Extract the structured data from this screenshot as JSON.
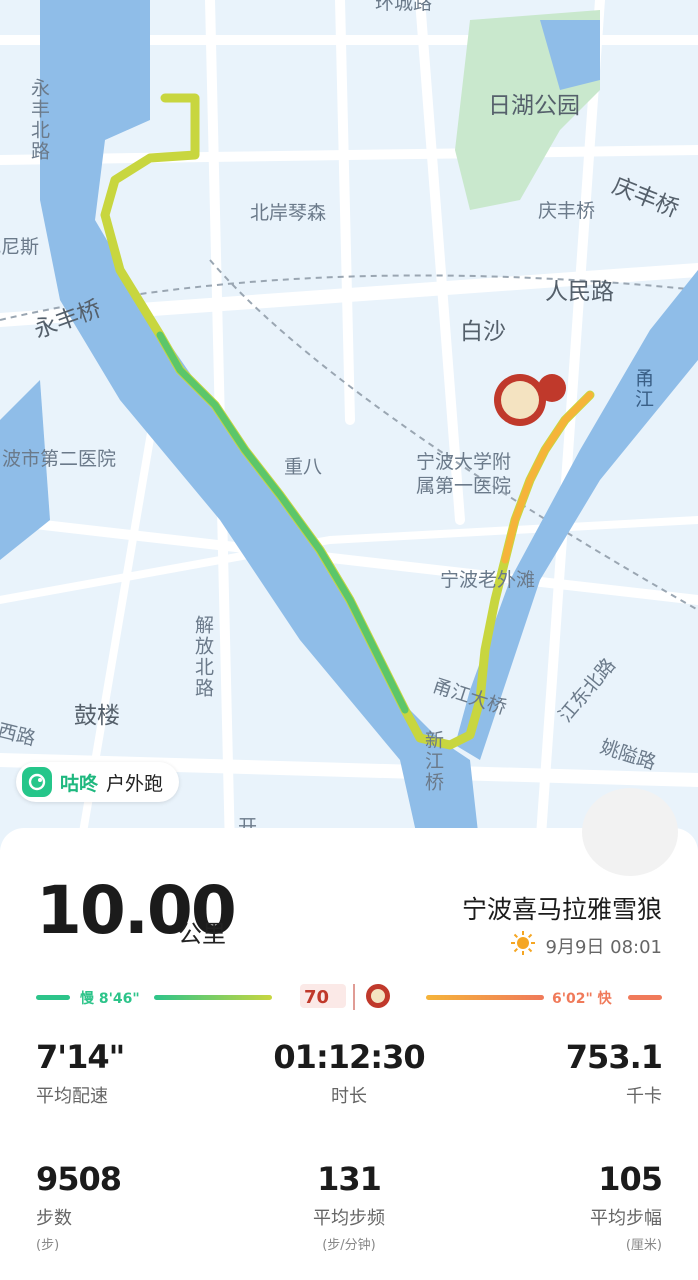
{
  "app": {
    "name": "咕咚",
    "mode": "户外跑"
  },
  "map": {
    "labels": {
      "huanchenglu": "环城路",
      "rihu_park": "日湖公园",
      "yongfeng_north": "永丰北路",
      "beian_qinsen": "北岸琴森",
      "qingfeng_bridge": "庆丰桥",
      "qingfeng": "庆丰桥",
      "venice": "威尼斯",
      "yongfeng_bridge": "永丰桥",
      "renmin_road": "人民路",
      "baisha": "白沙",
      "yongjiang": "甬江",
      "hospital2": "波市第二医院",
      "chongba": "重八",
      "ningbo_uni_hosp": "宁波大学附属第一医院",
      "laowaitan": "宁波老外滩",
      "jiefang_north": "解放北路",
      "gulou": "鼓楼",
      "yongjiang_bridge": "甬江大桥",
      "jiangdong_north": "江东北路",
      "yaodai_road": "姚隘路",
      "xijiang_bridge": "新江桥",
      "west_road": "西路",
      "kai": "开"
    }
  },
  "summary": {
    "distance": "10.00",
    "distance_unit": "公里",
    "team": "宁波喜马拉雅雪狼",
    "date": "9月9日 08:01"
  },
  "pace_legend": {
    "slow_label": "慢 8'46\"",
    "fast_label": "6'02\" 快"
  },
  "stats": {
    "avg_pace": {
      "value": "7'14\"",
      "label": "平均配速"
    },
    "duration": {
      "value": "01:12:30",
      "label": "时长"
    },
    "calories": {
      "value": "753.1",
      "label": "千卡"
    },
    "steps": {
      "value": "9508",
      "label": "步数",
      "unit": "(步)"
    },
    "cadence": {
      "value": "131",
      "label": "平均步频",
      "unit": "(步/分钟)"
    },
    "stride": {
      "value": "105",
      "label": "平均步幅",
      "unit": "(厘米)"
    }
  },
  "colors": {
    "route_green": "#5cc66a",
    "route_yellow": "#c8d63f",
    "route_orange": "#f5b43a",
    "river": "#8fbde8",
    "slow": "#2dc48a",
    "fast": "#f07a5a"
  }
}
